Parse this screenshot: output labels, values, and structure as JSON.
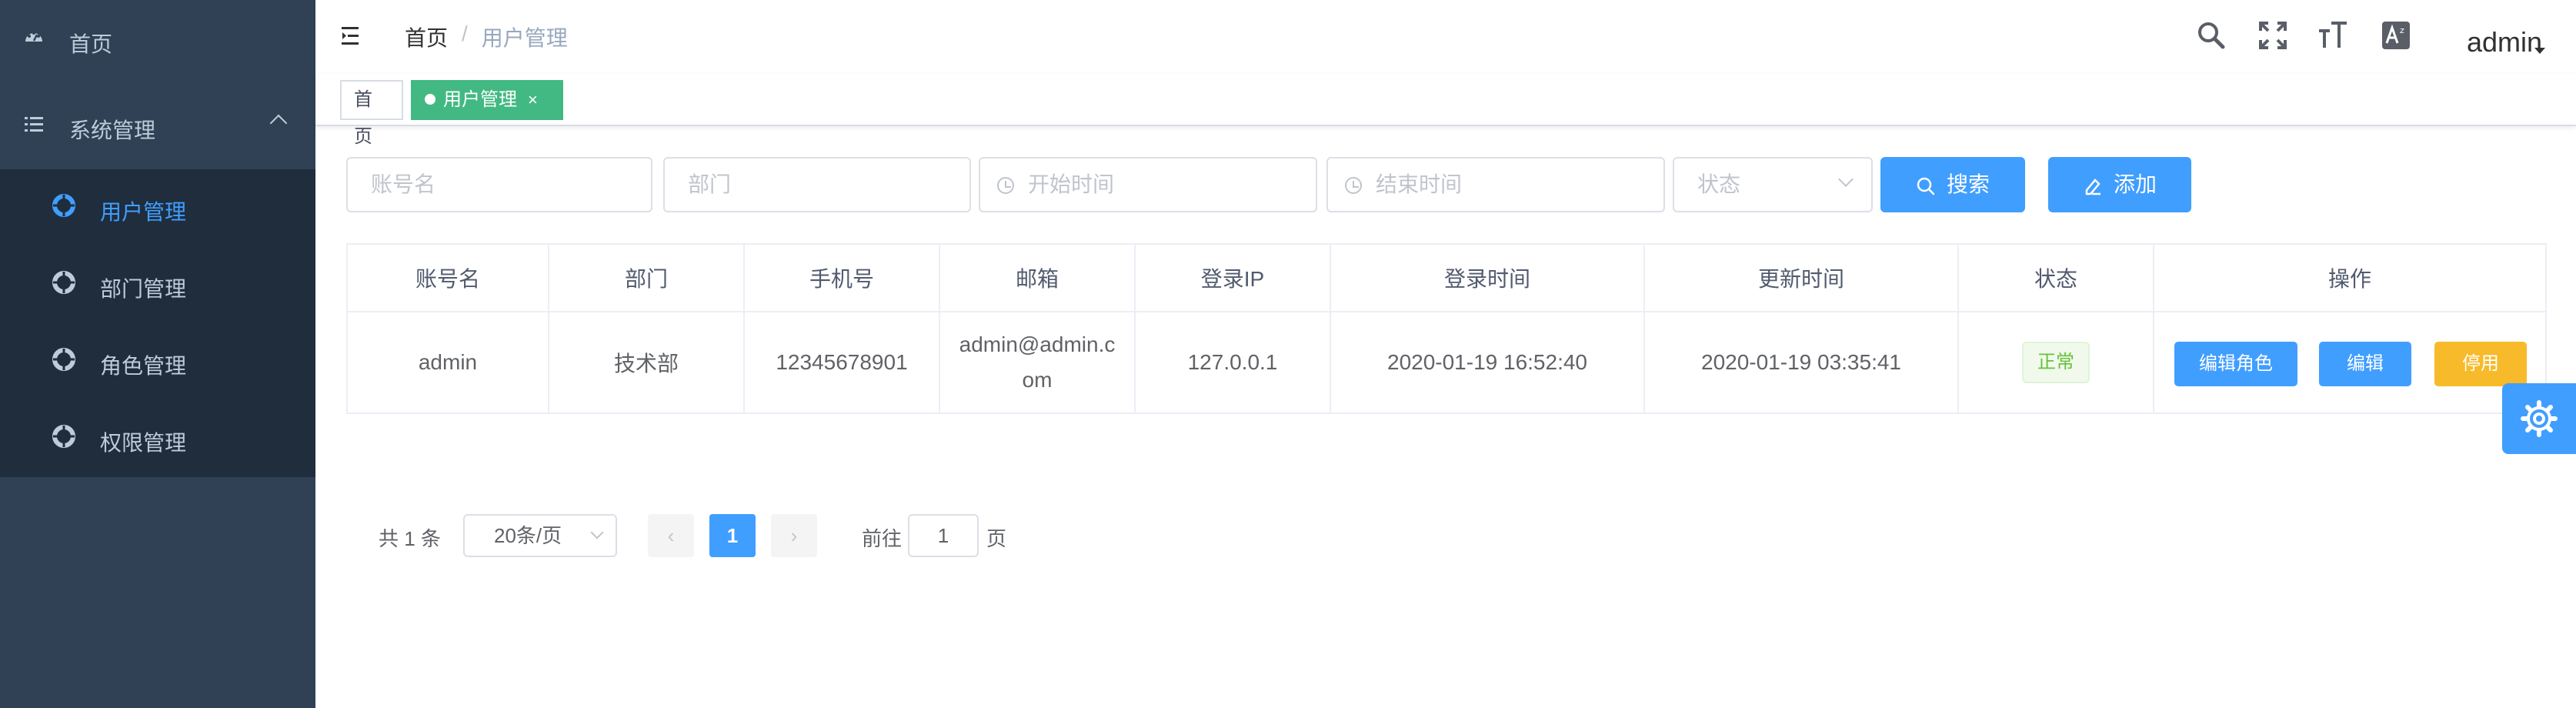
{
  "sidebar": {
    "home_label": "首页",
    "system_label": "系统管理",
    "items": [
      {
        "label": "用户管理",
        "active": true
      },
      {
        "label": "部门管理",
        "active": false
      },
      {
        "label": "角色管理",
        "active": false
      },
      {
        "label": "权限管理",
        "active": false
      }
    ]
  },
  "navbar": {
    "breadcrumb_home": "首页",
    "breadcrumb_sep": "/",
    "breadcrumb_current": "用户管理",
    "user": "admin"
  },
  "tags": [
    {
      "label": "首页"
    },
    {
      "label": "用户管理",
      "close": "×"
    }
  ],
  "filters": {
    "account_placeholder": "账号名",
    "dept_placeholder": "部门",
    "start_placeholder": "开始时间",
    "end_placeholder": "结束时间",
    "status_placeholder": "状态",
    "search_label": "搜索",
    "add_label": "添加"
  },
  "table": {
    "headers": [
      "账号名",
      "部门",
      "手机号",
      "邮箱",
      "登录IP",
      "登录时间",
      "更新时间",
      "状态",
      "操作"
    ],
    "rows": [
      {
        "account": "admin",
        "dept": "技术部",
        "phone": "12345678901",
        "email": "admin@admin.com",
        "ip": "127.0.0.1",
        "login_time": "2020-01-19 16:52:40",
        "update_time": "2020-01-19 03:35:41",
        "status": "正常",
        "actions": {
          "edit_role": "编辑角色",
          "edit": "编辑",
          "disable": "停用"
        }
      }
    ]
  },
  "pagination": {
    "total": "共 1 条",
    "page_size": "20条/页",
    "current": "1",
    "goto_label": "前往",
    "goto_value": "1",
    "page_suffix": "页"
  },
  "colors": {
    "sidebar_bg": "#304156",
    "submenu_bg": "#1f2d3d",
    "primary": "#409eff",
    "tag_active": "#42b983",
    "warning": "#f7ba2a",
    "success": "#67c23a"
  },
  "icons": [
    "dashboard-icon",
    "list-icon",
    "menu-item-icon",
    "hamburger-icon",
    "search-icon",
    "fullscreen-icon",
    "font-size-icon",
    "translate-icon",
    "clock-icon",
    "edit-icon",
    "settings-gear-icon"
  ]
}
